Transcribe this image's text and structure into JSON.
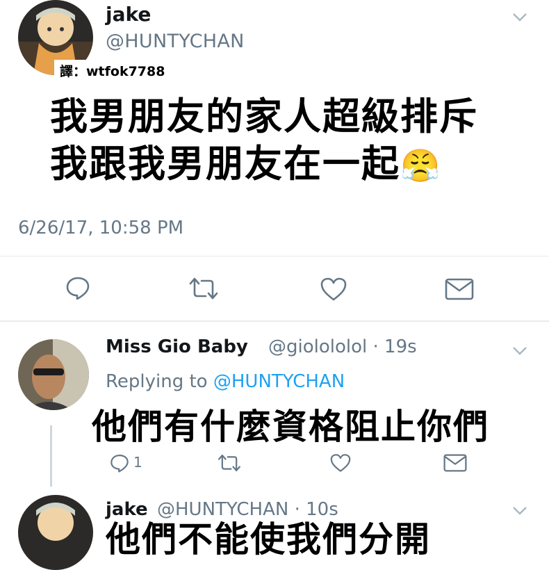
{
  "tweet": {
    "display_name": "jake",
    "handle": "@HUNTYCHAN",
    "translator_credit": "譯：wtfok7788",
    "line1": "我男朋友的家人超級排斥",
    "line2": "我跟我男朋友在一起",
    "emoji": "😤",
    "timestamp": "6/26/17, 10:58 PM"
  },
  "reply": {
    "display_name": "Miss Gio Baby",
    "handle_time": "@giolololol · 19s",
    "replying_prefix": "Replying to ",
    "replying_handle": "@HUNTYCHAN",
    "text": "他們有什麼資格阻止你們",
    "reply_count": "1"
  },
  "reply2": {
    "display_name": "jake",
    "handle_time": "@HUNTYCHAN · 10s",
    "text_partial": "他們不能使我們分開"
  },
  "icons": {
    "reply": "reply-icon",
    "retweet": "retweet-icon",
    "like": "heart-icon",
    "dm": "envelope-icon",
    "more": "chevron-down-icon"
  },
  "colors": {
    "name": "#14171a",
    "secondary": "#657786",
    "link": "#1da1f2",
    "divider": "#e6ecf0",
    "icon": "#657786"
  }
}
